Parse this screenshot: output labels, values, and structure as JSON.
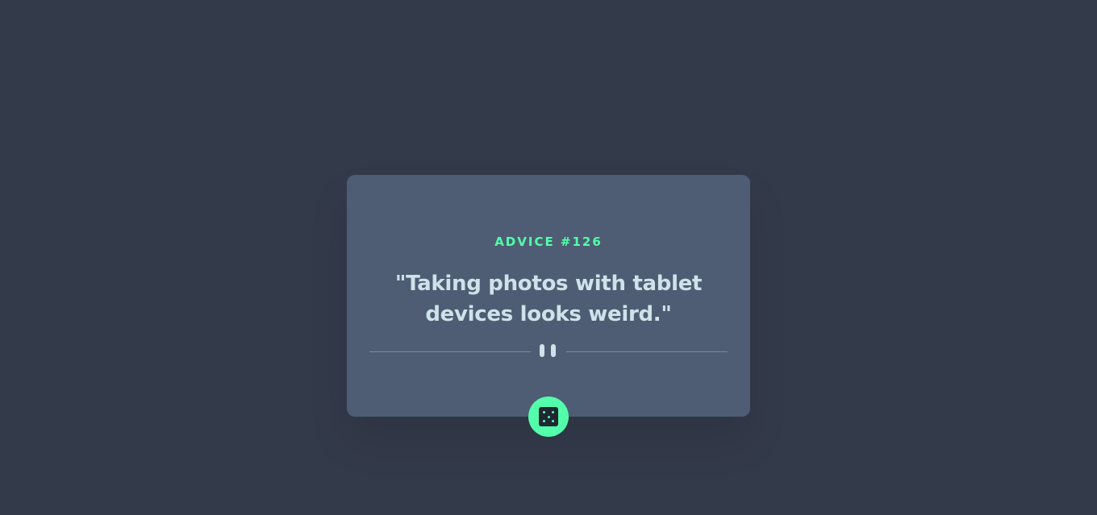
{
  "advice": {
    "label": "ADVICE #126",
    "text": "\"Taking photos with tablet devices looks weird.\""
  },
  "icons": {
    "divider": "pause-icon",
    "button": "dice-icon"
  },
  "colors": {
    "background": "#333a4a",
    "card": "#4e5d73",
    "accent": "#53ffaa",
    "text": "#cee3e9"
  }
}
